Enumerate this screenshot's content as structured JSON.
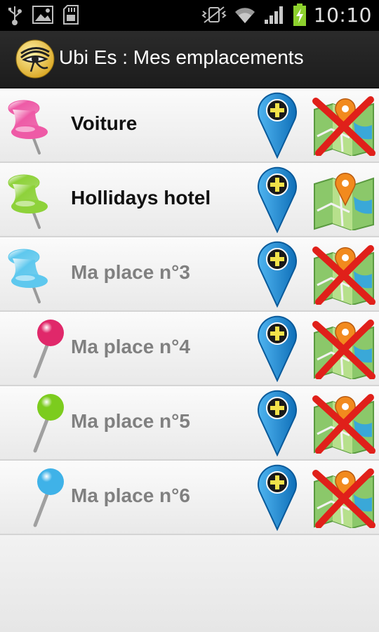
{
  "status_bar": {
    "time": "10:10",
    "left_icons": [
      "usb-icon",
      "image-icon",
      "sd-card-icon"
    ],
    "right_icons": [
      "vibrate-icon",
      "wifi-icon",
      "signal-icon",
      "battery-charging-icon"
    ]
  },
  "app": {
    "title": "Ubi Es : Mes emplacements",
    "icon": "eye-of-horus-icon"
  },
  "locations": [
    {
      "label": "Voiture",
      "pin": "pushpin",
      "pin_color": "#ee5aa6",
      "state": "active",
      "map_icon": "map-delete-icon"
    },
    {
      "label": "Hollidays hotel",
      "pin": "pushpin",
      "pin_color": "#8ed23a",
      "state": "active",
      "map_icon": "map-location-icon"
    },
    {
      "label": "Ma place n°3",
      "pin": "pushpin",
      "pin_color": "#5ec8ee",
      "state": "inactive",
      "map_icon": "map-delete-icon"
    },
    {
      "label": "Ma place n°4",
      "pin": "map-pin",
      "pin_color": "#e0286a",
      "state": "inactive",
      "map_icon": "map-delete-icon"
    },
    {
      "label": "Ma place n°5",
      "pin": "map-pin",
      "pin_color": "#7ccc1e",
      "state": "inactive",
      "map_icon": "map-delete-icon"
    },
    {
      "label": "Ma place n°6",
      "pin": "map-pin",
      "pin_color": "#3fb2e8",
      "state": "inactive",
      "map_icon": "map-delete-icon"
    }
  ],
  "colors": {
    "active_text": "#111111",
    "inactive_text": "#808080",
    "add_marker": "#1f8fd8",
    "delete_x": "#e0201a"
  }
}
